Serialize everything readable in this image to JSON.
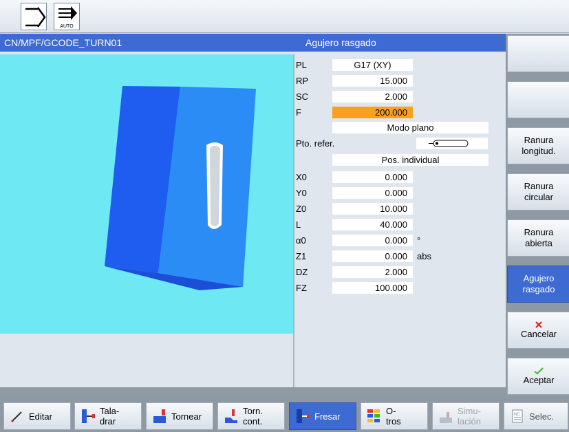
{
  "toolbar": {
    "auto_label": "AUTO"
  },
  "header": {
    "program_path": "CN/MPF/GCODE_TURN01",
    "cycle_title": "Agujero rasgado"
  },
  "params": [
    {
      "label": "PL",
      "value": "G17 (XY)",
      "unit": ""
    },
    {
      "label": "RP",
      "value": "15.000",
      "unit": ""
    },
    {
      "label": "SC",
      "value": "2.000",
      "unit": ""
    },
    {
      "label": "F",
      "value": "200.000",
      "unit": ""
    },
    {
      "label": "",
      "value": "Modo plano",
      "unit": ""
    },
    {
      "label": "Pto. refer.",
      "value": "",
      "unit": ""
    },
    {
      "label": "",
      "value": "Pos. individual",
      "unit": ""
    },
    {
      "label": "X0",
      "value": "0.000",
      "unit": ""
    },
    {
      "label": "Y0",
      "value": "0.000",
      "unit": ""
    },
    {
      "label": "Z0",
      "value": "10.000",
      "unit": ""
    },
    {
      "label": "L",
      "value": "40.000",
      "unit": ""
    },
    {
      "label": "α0",
      "value": "0.000",
      "unit": "°"
    },
    {
      "label": "Z1",
      "value": "0.000",
      "unit": "abs"
    },
    {
      "label": "DZ",
      "value": "2.000",
      "unit": ""
    },
    {
      "label": "FZ",
      "value": "100.000",
      "unit": ""
    }
  ],
  "softkeys": [
    {
      "line1": "",
      "line2": ""
    },
    {
      "line1": "",
      "line2": ""
    },
    {
      "line1": "Ranura",
      "line2": "longitud."
    },
    {
      "line1": "Ranura",
      "line2": "circular"
    },
    {
      "line1": "Ranura",
      "line2": "abierta"
    },
    {
      "line1": "Agujero",
      "line2": "rasgado"
    },
    {
      "line1": "Cancelar",
      "line2": ""
    },
    {
      "line1": "Aceptar",
      "line2": ""
    }
  ],
  "bottom_softkeys": [
    {
      "line1": "Editar",
      "line2": ""
    },
    {
      "line1": "Tala-",
      "line2": "drar"
    },
    {
      "line1": "Tornear",
      "line2": ""
    },
    {
      "line1": "Torn.",
      "line2": "cont."
    },
    {
      "line1": "Fresar",
      "line2": ""
    },
    {
      "line1": "O-",
      "line2": "tros"
    },
    {
      "line1": "Simu-",
      "line2": "lación"
    },
    {
      "line1": "Selec.",
      "line2": ""
    }
  ],
  "colors": {
    "accent": "#3e6bd1",
    "highlight": "#f7a21c",
    "graphic_bg": "#6ee8f2"
  }
}
